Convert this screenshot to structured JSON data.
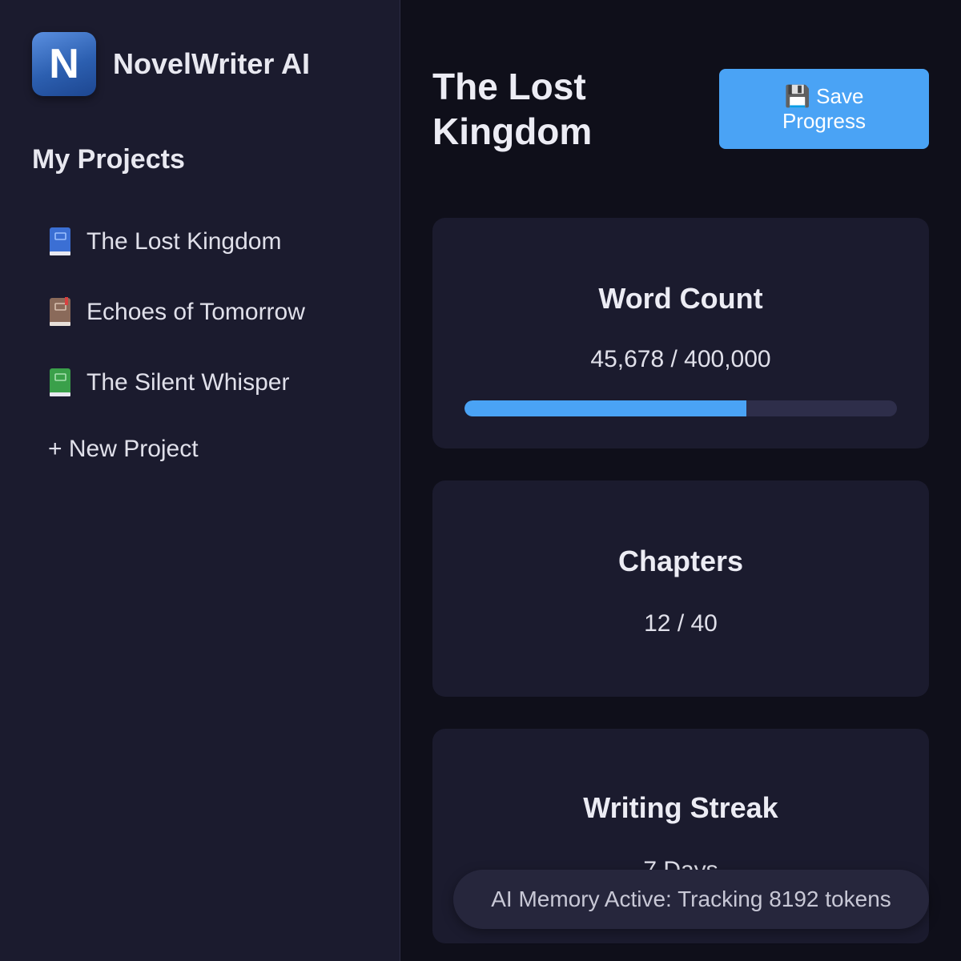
{
  "sidebar": {
    "logo_letter": "N",
    "app_name": "NovelWriter AI",
    "heading": "My Projects",
    "projects": [
      {
        "label": "The Lost Kingdom",
        "icon": "blue-book-icon",
        "color": "#3b6fd4"
      },
      {
        "label": "Echoes of Tomorrow",
        "icon": "ledger-book-icon",
        "color": "#8a6a5a"
      },
      {
        "label": "The Silent Whisper",
        "icon": "green-book-icon",
        "color": "#3aa04a"
      }
    ],
    "new_project_label": "+ New Project"
  },
  "main": {
    "title": "The Lost Kingdom",
    "save_button": {
      "icon": "floppy-disk-icon",
      "label": "💾 Save Progress"
    },
    "stats": {
      "word_count": {
        "title": "Word Count",
        "value": "45,678 / 400,000",
        "progress_fraction": 0.652
      },
      "chapters": {
        "title": "Chapters",
        "value": "12 / 40"
      },
      "streak": {
        "title": "Writing Streak",
        "value": "7 Days"
      }
    },
    "toast": "AI Memory Active: Tracking 8192 tokens"
  },
  "colors": {
    "accent": "#4aa3f5",
    "sidebar_bg": "#1b1b2e",
    "main_bg": "#0f0f1a",
    "card_bg": "#1b1b2e"
  }
}
